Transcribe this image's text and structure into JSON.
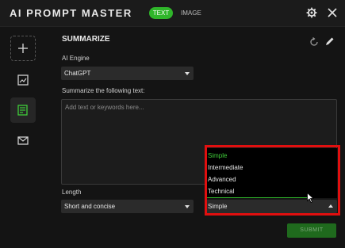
{
  "app": {
    "title": "AI PROMPT MASTER",
    "tabs": [
      {
        "label": "TEXT",
        "active": true
      },
      {
        "label": "IMAGE",
        "active": false
      }
    ],
    "accent_color": "#2fb52a"
  },
  "sidebar": {
    "items": [
      {
        "icon": "plus-icon"
      },
      {
        "icon": "image-edit-icon"
      },
      {
        "icon": "text-summarize-icon",
        "active": true
      },
      {
        "icon": "mail-icon"
      }
    ]
  },
  "main": {
    "section_title": "SUMMARIZE",
    "ai_engine": {
      "label": "AI Engine",
      "value": "ChatGPT"
    },
    "input": {
      "label": "Summarize the following text:",
      "placeholder": "Add text or keywords here..."
    },
    "length": {
      "label": "Length",
      "value": "Short and concise"
    },
    "level": {
      "value": "Simple",
      "options": [
        "Simple",
        "Intermediate",
        "Advanced",
        "Technical"
      ]
    },
    "submit_label": "SUBMIT"
  }
}
